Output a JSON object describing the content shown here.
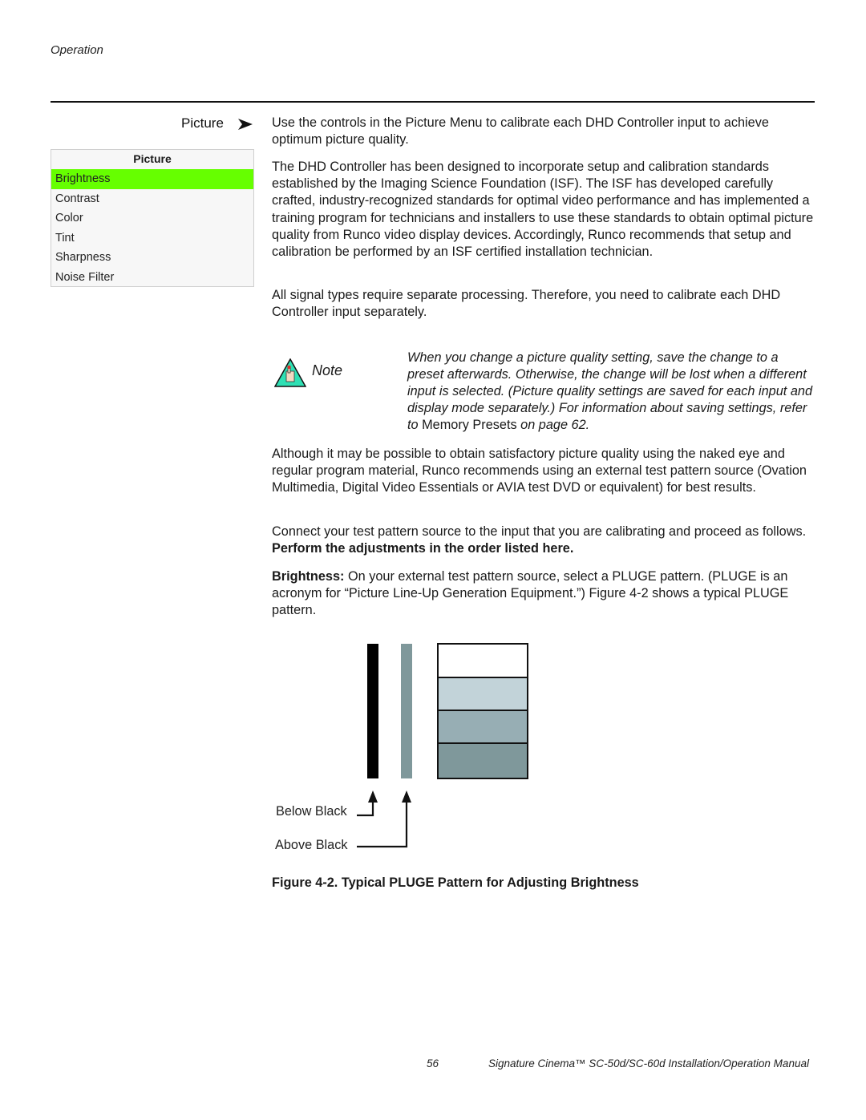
{
  "header": {
    "running_head": "Operation"
  },
  "section": {
    "title": "Picture",
    "arrow_icon": "right-arrowhead-icon"
  },
  "menu": {
    "title": "Picture",
    "items": [
      {
        "label": "Brightness",
        "selected": true
      },
      {
        "label": "Contrast",
        "selected": false
      },
      {
        "label": "Color",
        "selected": false
      },
      {
        "label": "Tint",
        "selected": false
      },
      {
        "label": "Sharpness",
        "selected": false
      },
      {
        "label": "Noise Filter",
        "selected": false
      }
    ],
    "highlight_color": "#66ff00"
  },
  "paragraphs": {
    "p1": "Use the controls in the Picture Menu to calibrate each DHD Controller input to achieve optimum picture quality.",
    "p2": "The DHD Controller has been designed to incorporate setup and calibration standards established by the Imaging Science Foundation (ISF). The ISF has developed carefully crafted, industry-recognized standards for optimal video performance and has implemented a training program for technicians and installers to use these standards to obtain optimal picture quality from Runco video display devices. Accordingly, Runco recommends that setup and calibration be performed by an ISF certified installation technician.",
    "p3": "All signal types require separate processing. Therefore, you need to calibrate each DHD Controller input separately.",
    "p4": "Although it may be possible to obtain satisfactory picture quality using the naked eye and regular program material, Runco recommends using an external test pattern source (Ovation Multimedia, Digital Video Essentials or AVIA test DVD or equivalent) for best results.",
    "p5_start": "Connect your test pattern source to the input that you are calibrating and proceed as follows. ",
    "p5_bold": "Perform the adjustments in the order listed here.",
    "p6_bold": "Brightness:",
    "p6_rest": " On your external test pattern source, select a PLUGE pattern. (PLUGE is an acronym for “Picture Line-Up Generation Equipment.”) Figure 4-2 shows a typical PLUGE pattern."
  },
  "note": {
    "label": "Note",
    "icon": "note-hand-icon",
    "text_before": "When you change a picture quality setting, save the change to a preset afterwards. Otherwise, the change will be lost when a different input is selected. (Picture quality settings are saved for each input and display mode separately.) For information about saving settings, refer to ",
    "ref": "Memory Presets",
    "text_after": "   on page 62."
  },
  "figure": {
    "below_black_label": "Below Black",
    "above_black_label": "Above Black",
    "caption": "Figure 4-2. Typical PLUGE Pattern for Adjusting Brightness",
    "colors": {
      "below_black_bar": "#000000",
      "above_black_bar": "#7f989b",
      "step1": "#ffffff",
      "step2": "#c2d3d9",
      "step3": "#97aeb4",
      "step4": "#7f989b"
    }
  },
  "footer": {
    "page_number": "56",
    "manual_title": "Signature Cinema™ SC-50d/SC-60d Installation/Operation Manual"
  }
}
